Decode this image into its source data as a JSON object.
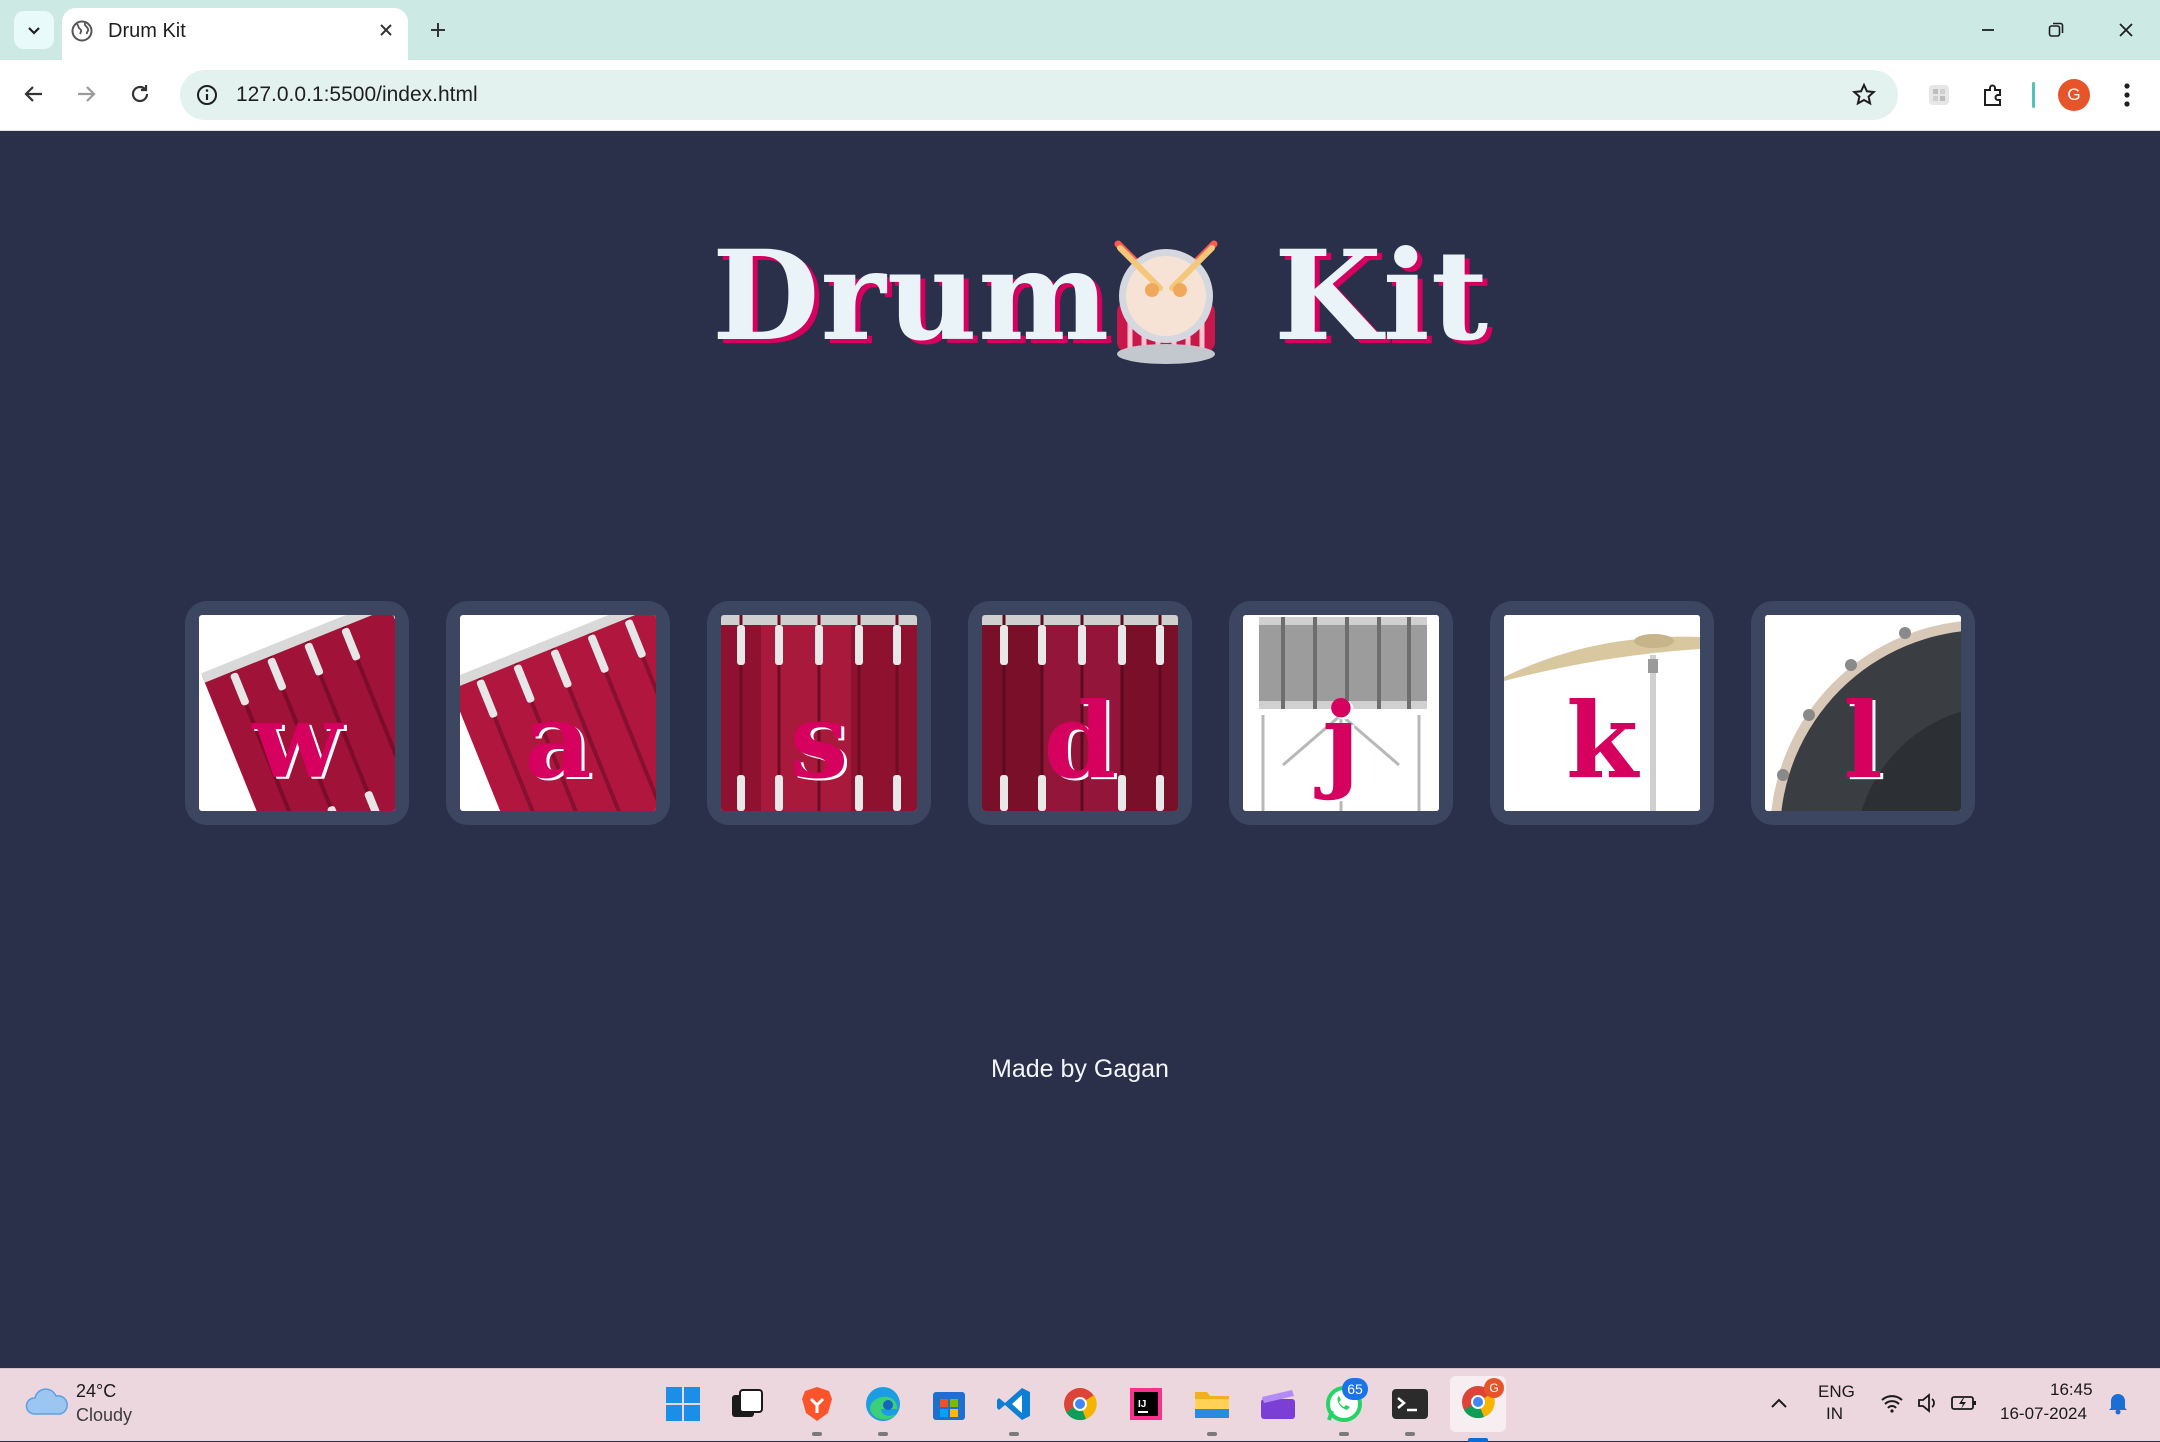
{
  "browser": {
    "tab_title": "Drum Kit",
    "url": "127.0.0.1:5500/index.html",
    "profile_initial": "G"
  },
  "page": {
    "title_word_1": "Drum",
    "title_word_2": "Kit",
    "footer": "Made by Gagan",
    "accent_color": "#d6005e",
    "background_color": "#2a3049",
    "keys": [
      {
        "letter": "w",
        "image": "tom-drum"
      },
      {
        "letter": "a",
        "image": "tom-drum"
      },
      {
        "letter": "s",
        "image": "snare-drum"
      },
      {
        "letter": "d",
        "image": "floor-tom"
      },
      {
        "letter": "j",
        "image": "snare-silver"
      },
      {
        "letter": "k",
        "image": "crash-cymbal"
      },
      {
        "letter": "l",
        "image": "bass-drum"
      }
    ]
  },
  "taskbar": {
    "weather_temp": "24°C",
    "weather_desc": "Cloudy",
    "whatsapp_badge": "65",
    "chrome_badge": "G",
    "lang_line1": "ENG",
    "lang_line2": "IN",
    "time": "16:45",
    "date": "16-07-2024"
  }
}
